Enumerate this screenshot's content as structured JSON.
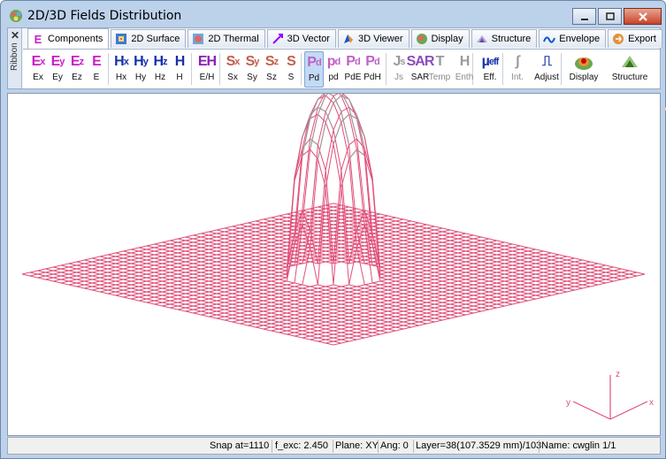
{
  "window": {
    "title": "2D/3D Fields Distribution"
  },
  "ribbon": {
    "side_label": "Ribbon",
    "close_glyph": "✕"
  },
  "tabs": [
    {
      "label": "Components",
      "icon": "E",
      "icon_color": "#c81fc8",
      "active": true
    },
    {
      "label": "2D Surface",
      "icon": "surface-icon"
    },
    {
      "label": "2D Thermal",
      "icon": "thermal-icon"
    },
    {
      "label": "3D Vector",
      "icon": "vector-icon"
    },
    {
      "label": "3D Viewer",
      "icon": "viewer-icon"
    },
    {
      "label": "Display",
      "icon": "display-icon"
    },
    {
      "label": "Structure",
      "icon": "structure-icon"
    },
    {
      "label": "Envelope",
      "icon": "envelope-icon"
    },
    {
      "label": "Export",
      "icon": "export-icon"
    }
  ],
  "tools": [
    {
      "label": "Ex",
      "glyph": "E",
      "sub": "x",
      "color": "#c81fc8"
    },
    {
      "label": "Ey",
      "glyph": "E",
      "sub": "y",
      "color": "#c81fc8"
    },
    {
      "label": "Ez",
      "glyph": "E",
      "sub": "z",
      "color": "#c81fc8"
    },
    {
      "label": "E",
      "glyph": "E",
      "sub": "",
      "color": "#c81fc8"
    },
    {
      "label": "Hx",
      "glyph": "H",
      "sub": "x",
      "color": "#1530a8"
    },
    {
      "label": "Hy",
      "glyph": "H",
      "sub": "y",
      "color": "#1530a8"
    },
    {
      "label": "Hz",
      "glyph": "H",
      "sub": "z",
      "color": "#1530a8"
    },
    {
      "label": "H",
      "glyph": "H",
      "sub": "",
      "color": "#1530a8"
    },
    {
      "label": "E/H",
      "glyph": "EH",
      "sub": "",
      "color": "#8a1fb8"
    },
    {
      "label": "Sx",
      "glyph": "S",
      "sub": "x",
      "color": "#c0604a"
    },
    {
      "label": "Sy",
      "glyph": "S",
      "sub": "y",
      "color": "#c0604a"
    },
    {
      "label": "Sz",
      "glyph": "S",
      "sub": "z",
      "color": "#c0604a"
    },
    {
      "label": "S",
      "glyph": "S",
      "sub": "",
      "color": "#c0604a"
    },
    {
      "label": "Pd",
      "glyph": "P",
      "sub": "d",
      "color": "#c060c8"
    },
    {
      "label": "pd",
      "glyph": "p",
      "sub": "d",
      "color": "#c060c8"
    },
    {
      "label": "PdE",
      "glyph": "P",
      "sub": "d",
      "color": "#c060c8"
    },
    {
      "label": "PdH",
      "glyph": "P",
      "sub": "d",
      "color": "#c060c8"
    },
    {
      "label": "Js",
      "glyph": "J",
      "sub": "s",
      "color": "#9a9a9a"
    },
    {
      "label": "SAR",
      "glyph": "SAR",
      "sub": "",
      "color": "#8c4cc0"
    },
    {
      "label": "Temp",
      "glyph": "T",
      "sub": "",
      "color": "#9a9a9a"
    },
    {
      "label": "Enth",
      "glyph": "H",
      "sub": "",
      "color": "#9a9a9a"
    },
    {
      "label": "Eff.",
      "glyph": "µ",
      "sub": "eff",
      "color": "#1530a8"
    },
    {
      "label": "Int.",
      "glyph": "∫",
      "sub": "",
      "color": "#9a9a9a"
    },
    {
      "label": "Adjust",
      "glyph": "⎍",
      "sub": "",
      "color": "#1530a8"
    },
    {
      "label": "Display",
      "glyph": "display-icon",
      "sub": "",
      "color": "#d04a20"
    },
    {
      "label": "Structure",
      "glyph": "structure-icon",
      "sub": "",
      "color": "#3a8a3a"
    }
  ],
  "axes": {
    "x": "x",
    "y": "y",
    "z": "z"
  },
  "status": {
    "snap": "Snap at=1110",
    "f_exc": "f_exc:  2.450",
    "plane": "Plane: XY",
    "ang": "Ang:   0",
    "layer": "Layer=38(107.3529 mm)/103",
    "name": "Name: cwglin 1/1"
  },
  "colors": {
    "mesh": "#e0507a",
    "peak_mesh": "#9a9a9a",
    "axis": "#e0507a"
  }
}
